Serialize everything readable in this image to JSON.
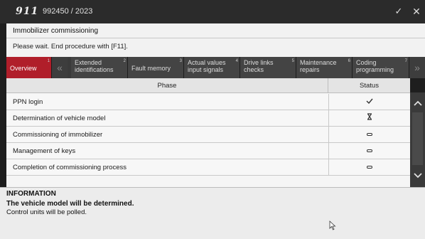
{
  "titlebar": {
    "logo": "911",
    "doc_number": "992450 / 2023",
    "settings_icon": "settings-check-icon",
    "close_icon": "close-icon"
  },
  "dialog": {
    "title": "Immobilizer commissioning",
    "message": "Please wait. End procedure with [F11]."
  },
  "tabs": [
    {
      "number": "1",
      "line1": "Overview",
      "line2": "",
      "active": true
    },
    {
      "number": "2",
      "line1": "Extended",
      "line2": "identifications",
      "active": false
    },
    {
      "number": "3",
      "line1": "Fault memory",
      "line2": "",
      "active": false
    },
    {
      "number": "4",
      "line1": "Actual values",
      "line2": "input signals",
      "active": false
    },
    {
      "number": "5",
      "line1": "Drive links",
      "line2": "checks",
      "active": false
    },
    {
      "number": "6",
      "line1": "Maintenance",
      "line2": "repairs",
      "active": false
    },
    {
      "number": "7",
      "line1": "Coding",
      "line2": "programming",
      "active": false
    }
  ],
  "table": {
    "headers": {
      "phase": "Phase",
      "status": "Status"
    },
    "rows": [
      {
        "phase": "PPN login",
        "status_icon": "checkmark-icon",
        "status_symbol": "✓"
      },
      {
        "phase": "Determination of vehicle model",
        "status_icon": "hourglass-icon",
        "status_symbol": "⧗"
      },
      {
        "phase": "Commissioning of immobilizer",
        "status_icon": "pending-icon",
        "status_symbol": ""
      },
      {
        "phase": "Management of keys",
        "status_icon": "pending-icon",
        "status_symbol": ""
      },
      {
        "phase": "Completion of commissioning process",
        "status_icon": "pending-icon",
        "status_symbol": ""
      }
    ]
  },
  "info": {
    "title": "INFORMATION",
    "line1": "The vehicle model will be determined.",
    "line2": "Control units will be polled."
  },
  "colors": {
    "active_tab": "#b01e2a",
    "titlebar": "#2b2b2b",
    "tab_bar": "#3a3a3a"
  }
}
